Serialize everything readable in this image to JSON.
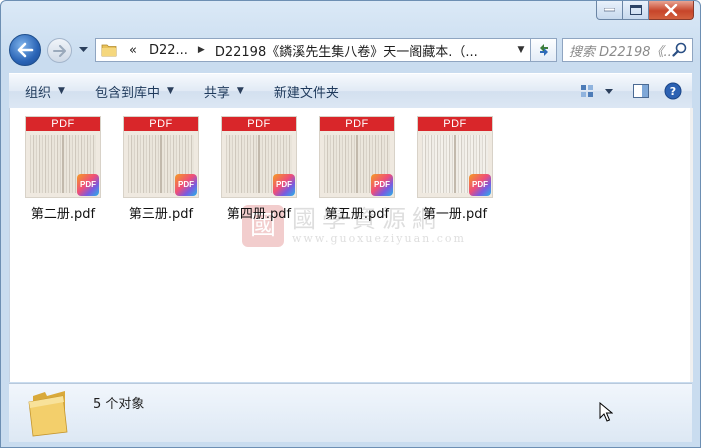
{
  "window": {
    "caption_buttons": {
      "minimize": "minimize",
      "maximize": "maximize",
      "close": "close"
    }
  },
  "address": {
    "overflow": "«",
    "segments": [
      "D22...",
      "D22198《鏻溪先生集八卷》天一阁藏本.（..."
    ]
  },
  "search": {
    "placeholder": "搜索 D22198《..."
  },
  "toolbar": {
    "organize": "组织",
    "include_library": "包含到库中",
    "share": "共享",
    "new_folder": "新建文件夹"
  },
  "files": [
    {
      "name": "第二册.pdf",
      "band": "PDF",
      "badge": "PDF"
    },
    {
      "name": "第三册.pdf",
      "band": "PDF",
      "badge": "PDF"
    },
    {
      "name": "第四册.pdf",
      "band": "PDF",
      "badge": "PDF"
    },
    {
      "name": "第五册.pdf",
      "band": "PDF",
      "badge": "PDF"
    },
    {
      "name": "第一册.pdf",
      "band": "PDF",
      "badge": "PDF"
    }
  ],
  "watermark": {
    "seal": "國",
    "title": "國學資源網",
    "url": "www.guoxueziyuan.com"
  },
  "status": {
    "count": "5 个对象"
  },
  "colors": {
    "pdf_red": "#d9262a",
    "accent_blue": "#2a64b6"
  }
}
